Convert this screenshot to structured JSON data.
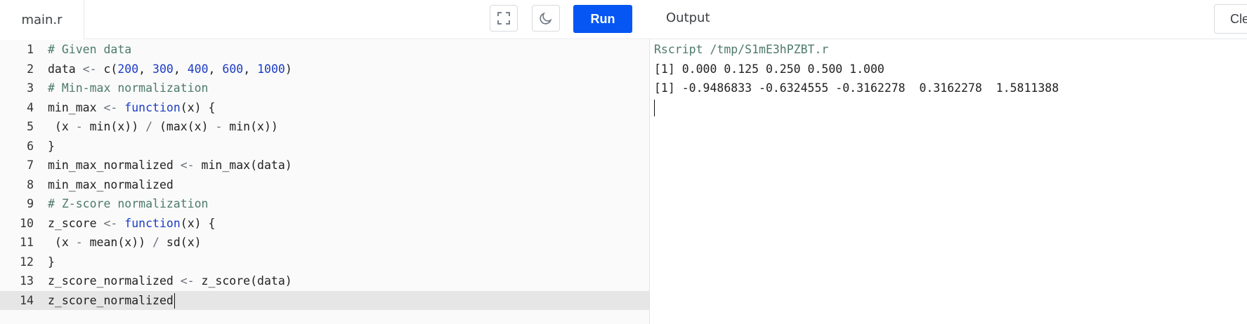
{
  "editor": {
    "file_tab": "main.r",
    "run_label": "Run",
    "lines": [
      {
        "num": "1",
        "tokens": [
          {
            "t": "# Given data",
            "c": "comment"
          }
        ]
      },
      {
        "num": "2",
        "tokens": [
          {
            "t": "data ",
            "c": ""
          },
          {
            "t": "<-",
            "c": "op"
          },
          {
            "t": " c(",
            "c": ""
          },
          {
            "t": "200",
            "c": "num"
          },
          {
            "t": ", ",
            "c": ""
          },
          {
            "t": "300",
            "c": "num"
          },
          {
            "t": ", ",
            "c": ""
          },
          {
            "t": "400",
            "c": "num"
          },
          {
            "t": ", ",
            "c": ""
          },
          {
            "t": "600",
            "c": "num"
          },
          {
            "t": ", ",
            "c": ""
          },
          {
            "t": "1000",
            "c": "num"
          },
          {
            "t": ")",
            "c": ""
          }
        ]
      },
      {
        "num": "3",
        "tokens": [
          {
            "t": "# Min-max normalization",
            "c": "comment"
          }
        ]
      },
      {
        "num": "4",
        "tokens": [
          {
            "t": "min_max ",
            "c": ""
          },
          {
            "t": "<-",
            "c": "op"
          },
          {
            "t": " ",
            "c": ""
          },
          {
            "t": "function",
            "c": "kw"
          },
          {
            "t": "(x) {",
            "c": ""
          }
        ]
      },
      {
        "num": "5",
        "tokens": [
          {
            "t": " (x ",
            "c": ""
          },
          {
            "t": "-",
            "c": "op"
          },
          {
            "t": " min(x)) ",
            "c": ""
          },
          {
            "t": "/",
            "c": "op"
          },
          {
            "t": " (max(x) ",
            "c": ""
          },
          {
            "t": "-",
            "c": "op"
          },
          {
            "t": " min(x))",
            "c": ""
          }
        ]
      },
      {
        "num": "6",
        "tokens": [
          {
            "t": "}",
            "c": ""
          }
        ]
      },
      {
        "num": "7",
        "tokens": [
          {
            "t": "min_max_normalized ",
            "c": ""
          },
          {
            "t": "<-",
            "c": "op"
          },
          {
            "t": " min_max(data)",
            "c": ""
          }
        ]
      },
      {
        "num": "8",
        "tokens": [
          {
            "t": "min_max_normalized",
            "c": ""
          }
        ]
      },
      {
        "num": "9",
        "tokens": [
          {
            "t": "# Z-score normalization",
            "c": "comment"
          }
        ]
      },
      {
        "num": "10",
        "tokens": [
          {
            "t": "z_score ",
            "c": ""
          },
          {
            "t": "<-",
            "c": "op"
          },
          {
            "t": " ",
            "c": ""
          },
          {
            "t": "function",
            "c": "kw"
          },
          {
            "t": "(x) {",
            "c": ""
          }
        ]
      },
      {
        "num": "11",
        "tokens": [
          {
            "t": " (x ",
            "c": ""
          },
          {
            "t": "-",
            "c": "op"
          },
          {
            "t": " mean(x)) ",
            "c": ""
          },
          {
            "t": "/",
            "c": "op"
          },
          {
            "t": " sd(x)",
            "c": ""
          }
        ]
      },
      {
        "num": "12",
        "tokens": [
          {
            "t": "}",
            "c": ""
          }
        ]
      },
      {
        "num": "13",
        "tokens": [
          {
            "t": "z_score_normalized ",
            "c": ""
          },
          {
            "t": "<-",
            "c": "op"
          },
          {
            "t": " z_score(data)",
            "c": ""
          }
        ]
      },
      {
        "num": "14",
        "tokens": [
          {
            "t": "z_score_normalized",
            "c": ""
          }
        ],
        "active": true
      }
    ]
  },
  "output": {
    "title": "Output",
    "clear_label": "Clear",
    "lines": [
      {
        "text": "Rscript /tmp/S1mE3hPZBT.r",
        "kind": "cmd"
      },
      {
        "text": "[1] 0.000 0.125 0.250 0.500 1.000",
        "kind": "out"
      },
      {
        "text": "[1] -0.9486833 -0.6324555 -0.3162278  0.3162278  1.5811388",
        "kind": "out"
      }
    ]
  },
  "colors": {
    "run_button": "#0556f3",
    "comment": "#4d7a6a",
    "number": "#1b3cc4",
    "active_line": "#e6e6e6"
  },
  "icons": [
    "fullscreen-icon",
    "moon-icon"
  ]
}
